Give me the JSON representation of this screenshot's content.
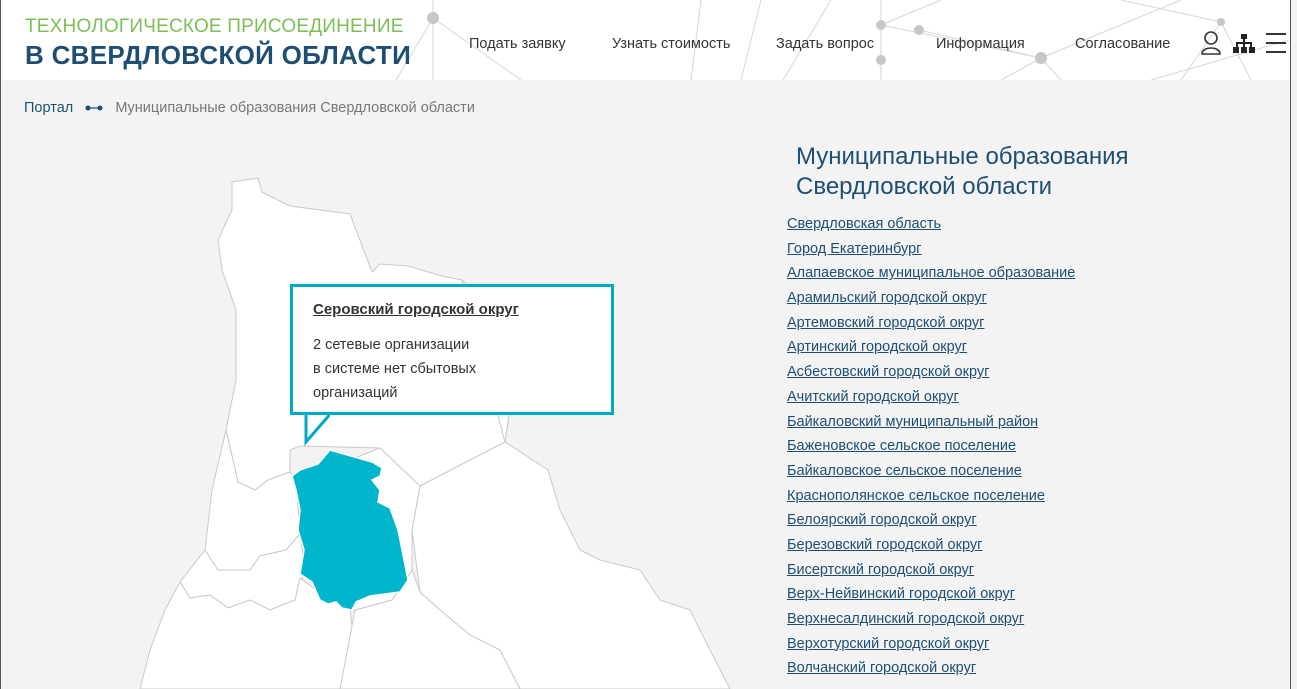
{
  "header": {
    "logo_line1": "ТЕХНОЛОГИЧЕСКОЕ ПРИСОЕДИНЕНИЕ",
    "logo_line2": "В СВЕРДЛОВСКОЙ ОБЛАСТИ",
    "nav": [
      "Подать заявку",
      "Узнать стоимость",
      "Задать вопрос",
      "Информация",
      "Согласование"
    ],
    "icons": [
      "user-icon",
      "sitemap-icon",
      "menu-icon"
    ]
  },
  "breadcrumb": {
    "home": "Портал",
    "current": "Муниципальные образования Свердловской области"
  },
  "tooltip": {
    "title": "Серовский городской округ",
    "line1": "2 сетевые организации",
    "line2": "в системе нет сбытовых",
    "line3": "организаций"
  },
  "sidebar": {
    "title": "Муниципальные образования Свердловской области",
    "items": [
      "Свердловская область",
      "Город Екатеринбург",
      "Алапаевское муниципальное образование",
      "Арамильский городской округ",
      "Артемовский городской округ",
      "Артинский городской округ",
      "Асбестовский городской округ",
      "Ачитский городской округ",
      "Байкаловский муниципальный район",
      "Баженовское сельское поселение",
      "Байкаловское сельское поселение",
      "Краснополянское сельское поселение",
      "Белоярский городской округ",
      "Березовский городской округ",
      "Бисертский городской округ",
      "Верх-Нейвинский городской округ",
      "Верхнесалдинский городской округ",
      "Верхотурский городской округ",
      "Волчанский городской округ"
    ]
  },
  "colors": {
    "brand_green": "#7cbf55",
    "brand_blue": "#1e4f72",
    "highlight": "#00b5cc",
    "tooltip_border": "#00a9c6"
  }
}
